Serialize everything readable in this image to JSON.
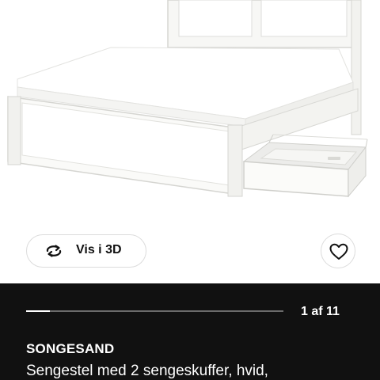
{
  "product": {
    "name": "SONGESAND",
    "description": "Sengestel med 2 sengeskuffer, hvid,"
  },
  "actions": {
    "view_3d_label": "Vis i 3D",
    "view_3d_icon": "rotate-3d-icon",
    "favourite_icon": "heart-outline-icon"
  },
  "gallery": {
    "counter": "1 af 11",
    "current": 1,
    "total": 11
  },
  "colors": {
    "panel_background": "#111111",
    "text_on_panel": "#ffffff",
    "track": "#6b6b6b"
  }
}
